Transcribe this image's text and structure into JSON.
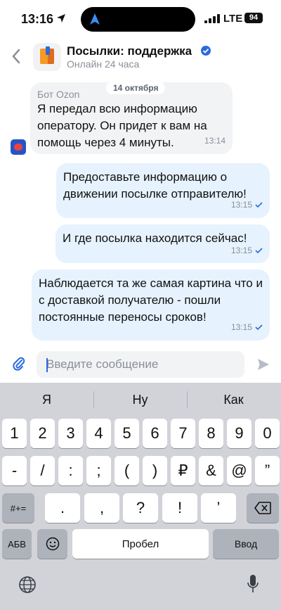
{
  "status_bar": {
    "time": "13:16",
    "network": "LTE",
    "battery": "94"
  },
  "header": {
    "title": "Посылки: поддержка",
    "subtitle": "Онлайн 24 часа"
  },
  "date_separator": "14 октября",
  "messages": [
    {
      "direction": "in",
      "sender": "Бот Ozon",
      "text": "Я передал всю информацию оператору. Он придет к вам на помощь через 4 минуты.",
      "time": "13:14"
    },
    {
      "direction": "out",
      "text": "Предоставьте информацию о движении посылке отправителю!",
      "time": "13:15"
    },
    {
      "direction": "out",
      "text": "И где посылка находится сейчас!",
      "time": "13:15"
    },
    {
      "direction": "out",
      "text": "Наблюдается та же самая картина что и с доставкой получателю - пошли постоянные переносы сроков!",
      "time": "13:15"
    }
  ],
  "composer": {
    "placeholder": "Введите сообщение"
  },
  "keyboard": {
    "suggestions": [
      "Я",
      "Ну",
      "Как"
    ],
    "row1": [
      "1",
      "2",
      "3",
      "4",
      "5",
      "6",
      "7",
      "8",
      "9",
      "0"
    ],
    "row2": [
      "-",
      "/",
      ":",
      ";",
      "(",
      ")",
      "₽",
      "&",
      "@",
      "”"
    ],
    "row3": {
      "toggle": "#+=",
      "keys": [
        ".",
        ",",
        "?",
        "!",
        "’"
      ]
    },
    "row4": {
      "abc": "АБВ",
      "space": "Пробел",
      "enter": "Ввод"
    }
  },
  "colors": {
    "accent": "#2a6ae0",
    "outgoing_bubble": "#e6f2fd",
    "incoming_bubble": "#f2f3f5",
    "keyboard_bg": "#d1d3d9"
  }
}
